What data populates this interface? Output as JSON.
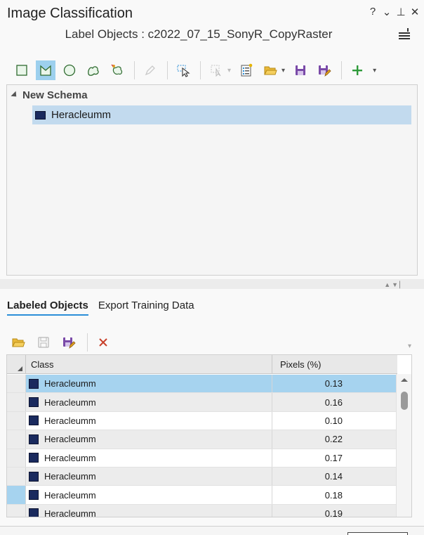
{
  "pane": {
    "title": "Image Classification",
    "controls": {
      "help": "?",
      "options": "⌄",
      "pin": "⊥",
      "close": "✕"
    }
  },
  "subtitle": "Label Objects : c2022_07_15_SonyR_CopyRaster",
  "toolbar_icons": [
    "rectangle-icon",
    "polygon-icon",
    "circle-icon",
    "freehand-icon",
    "auto-detect-icon",
    "edit-pencil-icon",
    "select-icon",
    "collect-icon",
    "properties-icon",
    "open-folder-icon",
    "save-icon",
    "save-as-icon",
    "add-icon"
  ],
  "schema": {
    "root_label": "New Schema",
    "classes": [
      {
        "label": "Heracleumm",
        "color": "#1a2a5e"
      }
    ]
  },
  "tabs": [
    {
      "label": "Labeled Objects",
      "active": true
    },
    {
      "label": "Export Training Data",
      "active": false
    }
  ],
  "grid": {
    "columns": [
      "Class",
      "Pixels (%)"
    ],
    "rows": [
      {
        "class": "Heracleumm",
        "pixels": "0.13"
      },
      {
        "class": "Heracleumm",
        "pixels": "0.16"
      },
      {
        "class": "Heracleumm",
        "pixels": "0.10"
      },
      {
        "class": "Heracleumm",
        "pixels": "0.22"
      },
      {
        "class": "Heracleumm",
        "pixels": "0.17"
      },
      {
        "class": "Heracleumm",
        "pixels": "0.14"
      },
      {
        "class": "Heracleumm",
        "pixels": "0.18"
      },
      {
        "class": "Heracleumm",
        "pixels": "0.19"
      }
    ]
  },
  "colors": {
    "accent": "#2b8fd8",
    "selection": "#a6d3ef",
    "class_swatch": "#1a2a5e",
    "add_green": "#2e9a3a",
    "delete_red": "#c8402a"
  }
}
